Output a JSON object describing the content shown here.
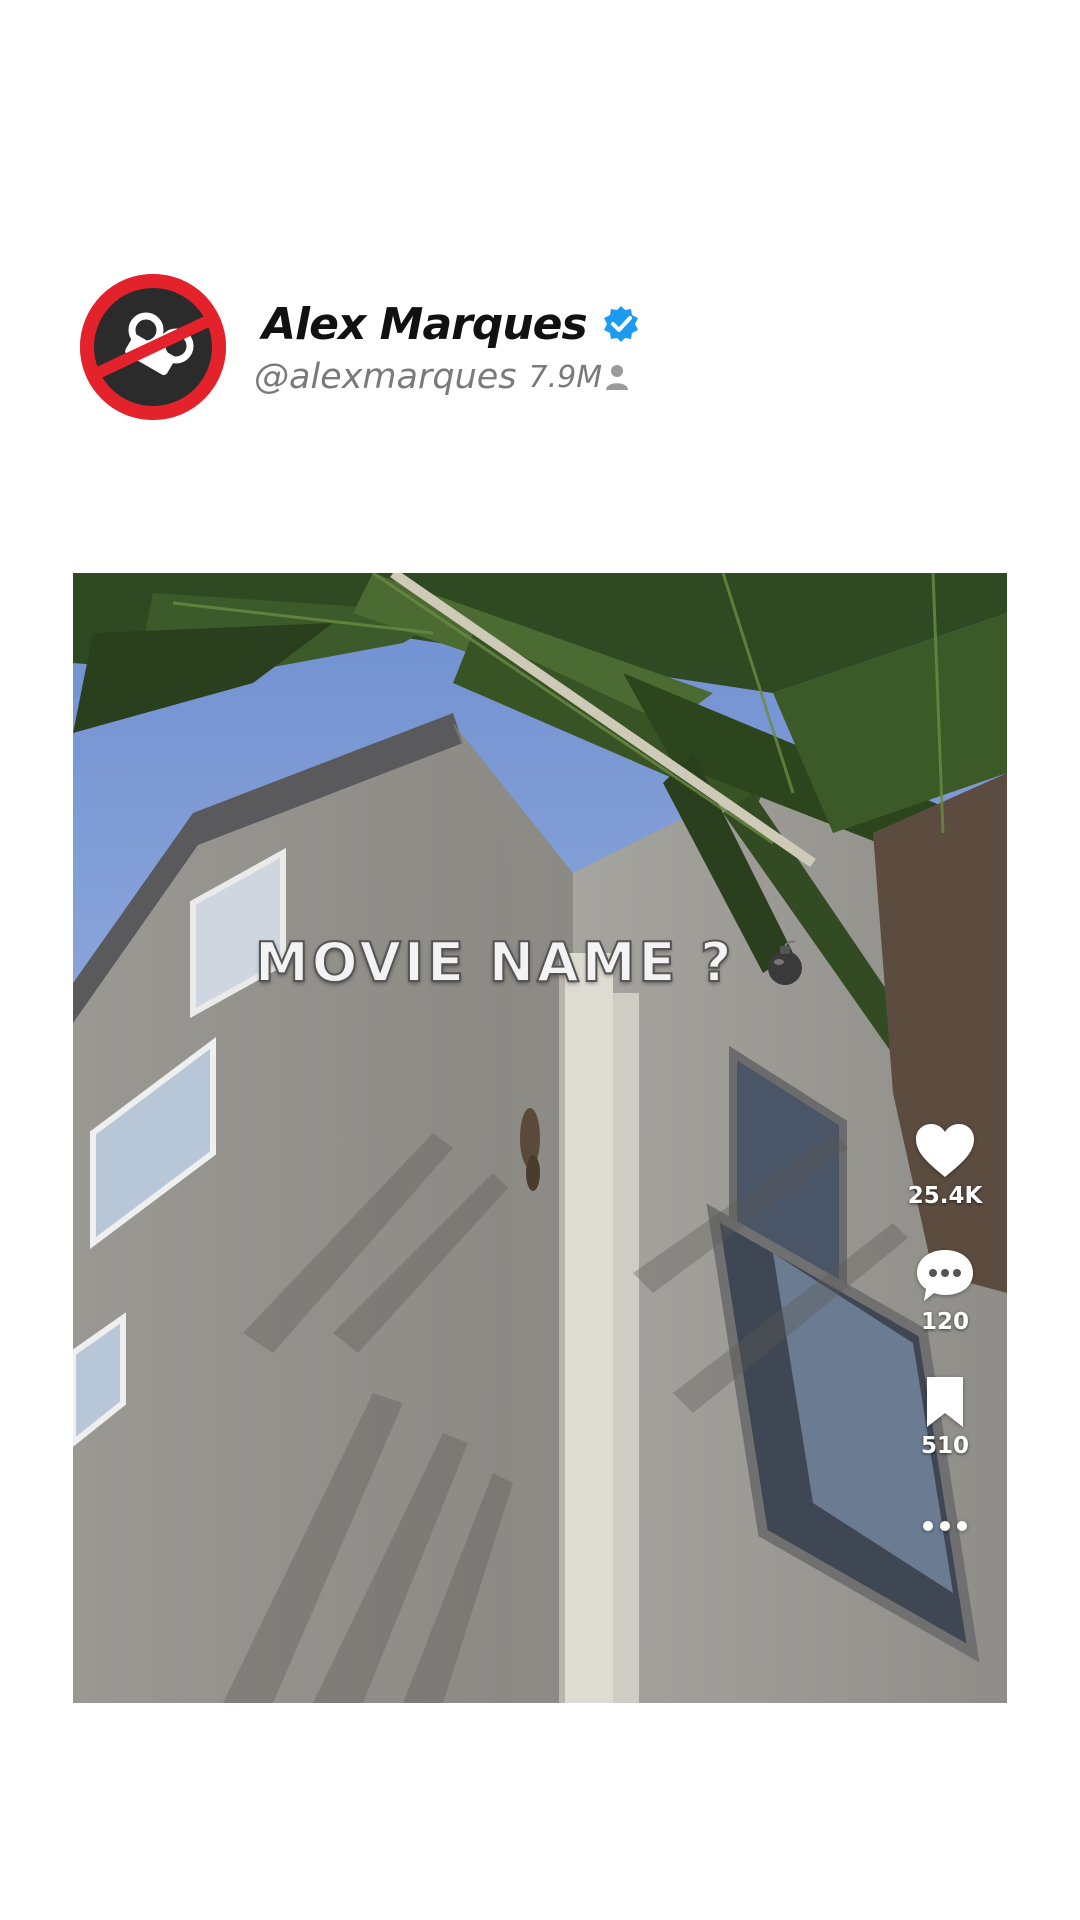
{
  "profile": {
    "display_name": "Alex Marques",
    "handle": "@alexmarques",
    "followers": "7.9M",
    "avatar_icon": "no-filming-icon",
    "verified_icon": "verified-badge-icon",
    "followers_icon": "person-icon"
  },
  "video": {
    "overlay_text": "MOVIE NAME ?",
    "overlay_icon": "bomb-icon"
  },
  "actions": {
    "like": {
      "icon": "heart-icon",
      "count": "25.4K"
    },
    "comment": {
      "icon": "comment-bubble-icon",
      "count": "120"
    },
    "save": {
      "icon": "bookmark-icon",
      "count": "510"
    },
    "more": {
      "icon": "more-dots-icon"
    }
  },
  "colors": {
    "verified": "#1d9bf0",
    "avatar_ring": "#e3222c",
    "handle_text": "#7a7a7a"
  }
}
